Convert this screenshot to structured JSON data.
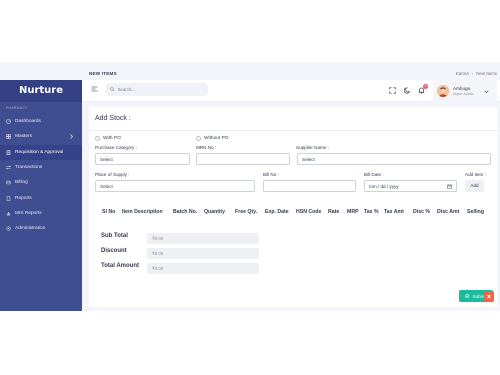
{
  "app": {
    "brand": "Nurture"
  },
  "header": {
    "page_title": "NEW ITEMS",
    "breadcrumb": [
      "Karma",
      "New Items"
    ],
    "search_placeholder": "Search...",
    "notification_count": "0"
  },
  "user": {
    "name": "Ambuga",
    "role": "Super Admin"
  },
  "sidebar": {
    "section": "PHARMACY",
    "items": [
      {
        "label": "Dashboards",
        "icon": "dashboard-icon"
      },
      {
        "label": "Masters",
        "icon": "grid-icon"
      },
      {
        "label": "Requisition & Approval",
        "icon": "clipboard-icon"
      },
      {
        "label": "Transactions",
        "icon": "transfer-icon"
      },
      {
        "label": "Billing",
        "icon": "bill-icon"
      },
      {
        "label": "Reports",
        "icon": "report-icon"
      },
      {
        "label": "MIS Reports",
        "icon": "chart-icon"
      },
      {
        "label": "Administration",
        "icon": "settings-icon"
      }
    ]
  },
  "form": {
    "title": "Add Stock :",
    "radio_with_po": "With PO",
    "radio_without_po": "Without PO",
    "purchase_category_label": "Purchase Category :",
    "purchase_category_value": "Select",
    "mrn_label": "MRN No :",
    "mrn_value": "",
    "supplier_label": "Supplier Name :",
    "supplier_value": "Select",
    "place_label": "Place of Supply :",
    "place_value": "Select",
    "bill_no_label": "Bill No :",
    "bill_no_value": "",
    "bill_date_label": "Bill Date :",
    "bill_date_value": "mm / dd / yyyy",
    "add_item_label": "Add Item :",
    "add_button": "Add"
  },
  "table": {
    "columns": [
      "Sl No",
      "Item Description",
      "Batch No.",
      "Quantity",
      "Free Qty.",
      "Exp. Date",
      "HSN Code",
      "Rate",
      "MRP",
      "Tax %",
      "Tax Amt",
      "Disc %",
      "Disc Amt",
      "Selling"
    ]
  },
  "totals": {
    "sub_total_label": "Sub Total",
    "sub_total_value": "₹0.00",
    "discount_label": "Discount",
    "discount_value": "₹0.00",
    "total_amount_label": "Total Amount",
    "total_amount_value": "₹0.00"
  },
  "submit_label": "Submit",
  "colors": {
    "sidebar": "#3f4d91",
    "accent": "#1abc9c",
    "danger": "#f06548"
  }
}
